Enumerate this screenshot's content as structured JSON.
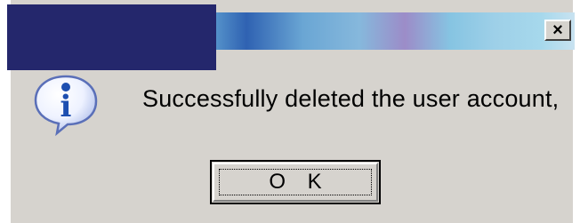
{
  "dialog": {
    "close_glyph": "×",
    "icon": "info-icon",
    "icon_letter": "i",
    "message": "Successfully deleted the user account,",
    "ok_label": "O K"
  },
  "colors": {
    "dialog_bg": "#d6d3ce",
    "redaction": "#24276c",
    "icon_blue": "#1d4fb0"
  }
}
